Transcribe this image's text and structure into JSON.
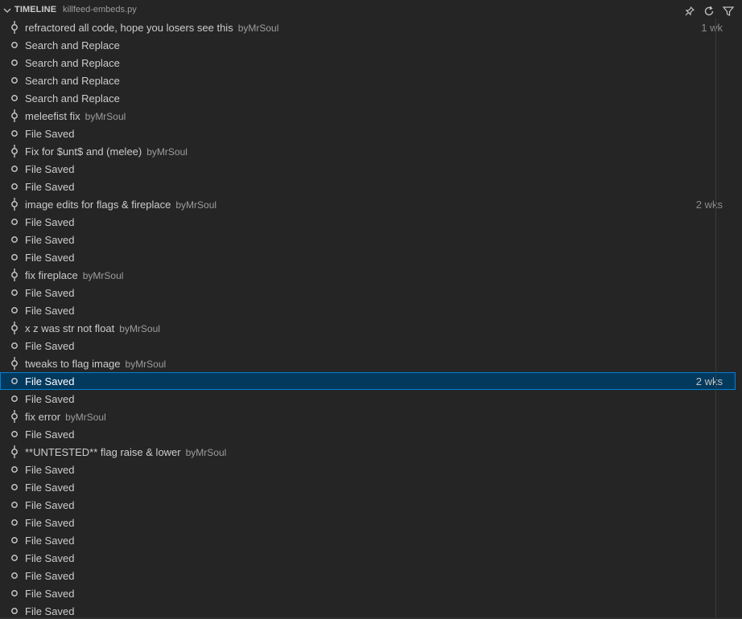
{
  "header": {
    "title": "TIMELINE",
    "file": "killfeed-embeds.py",
    "actions": [
      {
        "icon": "pin-icon"
      },
      {
        "icon": "refresh-icon"
      },
      {
        "icon": "filter-icon"
      }
    ]
  },
  "rows": [
    {
      "type": "commit",
      "label": "refractored all code, hope you losers see this",
      "desc": "byMrSoul",
      "time": "1 wk"
    },
    {
      "type": "local",
      "label": "Search and Replace",
      "desc": "",
      "time": ""
    },
    {
      "type": "local",
      "label": "Search and Replace",
      "desc": "",
      "time": ""
    },
    {
      "type": "local",
      "label": "Search and Replace",
      "desc": "",
      "time": ""
    },
    {
      "type": "local",
      "label": "Search and Replace",
      "desc": "",
      "time": ""
    },
    {
      "type": "commit",
      "label": "meleefist fix",
      "desc": "byMrSoul",
      "time": ""
    },
    {
      "type": "local",
      "label": "File Saved",
      "desc": "",
      "time": ""
    },
    {
      "type": "commit",
      "label": "Fix for $unt$ and (melee)",
      "desc": "byMrSoul",
      "time": ""
    },
    {
      "type": "local",
      "label": "File Saved",
      "desc": "",
      "time": ""
    },
    {
      "type": "local",
      "label": "File Saved",
      "desc": "",
      "time": ""
    },
    {
      "type": "commit",
      "label": "image edits for flags & fireplace",
      "desc": "byMrSoul",
      "time": "2 wks"
    },
    {
      "type": "local",
      "label": "File Saved",
      "desc": "",
      "time": ""
    },
    {
      "type": "local",
      "label": "File Saved",
      "desc": "",
      "time": ""
    },
    {
      "type": "local",
      "label": "File Saved",
      "desc": "",
      "time": ""
    },
    {
      "type": "commit",
      "label": "fix fireplace",
      "desc": "byMrSoul",
      "time": ""
    },
    {
      "type": "local",
      "label": "File Saved",
      "desc": "",
      "time": ""
    },
    {
      "type": "local",
      "label": "File Saved",
      "desc": "",
      "time": ""
    },
    {
      "type": "commit",
      "label": "x z was str not float",
      "desc": "byMrSoul",
      "time": ""
    },
    {
      "type": "local",
      "label": "File Saved",
      "desc": "",
      "time": ""
    },
    {
      "type": "commit",
      "label": "tweaks to flag image",
      "desc": "byMrSoul",
      "time": ""
    },
    {
      "type": "local",
      "label": "File Saved",
      "desc": "",
      "time": "2 wks",
      "selected": true
    },
    {
      "type": "local",
      "label": "File Saved",
      "desc": "",
      "time": ""
    },
    {
      "type": "commit",
      "label": "fix error",
      "desc": "byMrSoul",
      "time": ""
    },
    {
      "type": "local",
      "label": "File Saved",
      "desc": "",
      "time": ""
    },
    {
      "type": "commit",
      "label": "**UNTESTED** flag raise & lower",
      "desc": "byMrSoul",
      "time": ""
    },
    {
      "type": "local",
      "label": "File Saved",
      "desc": "",
      "time": ""
    },
    {
      "type": "local",
      "label": "File Saved",
      "desc": "",
      "time": ""
    },
    {
      "type": "local",
      "label": "File Saved",
      "desc": "",
      "time": ""
    },
    {
      "type": "local",
      "label": "File Saved",
      "desc": "",
      "time": ""
    },
    {
      "type": "local",
      "label": "File Saved",
      "desc": "",
      "time": ""
    },
    {
      "type": "local",
      "label": "File Saved",
      "desc": "",
      "time": ""
    },
    {
      "type": "local",
      "label": "File Saved",
      "desc": "",
      "time": ""
    },
    {
      "type": "local",
      "label": "File Saved",
      "desc": "",
      "time": ""
    },
    {
      "type": "local",
      "label": "File Saved",
      "desc": "",
      "time": ""
    }
  ]
}
